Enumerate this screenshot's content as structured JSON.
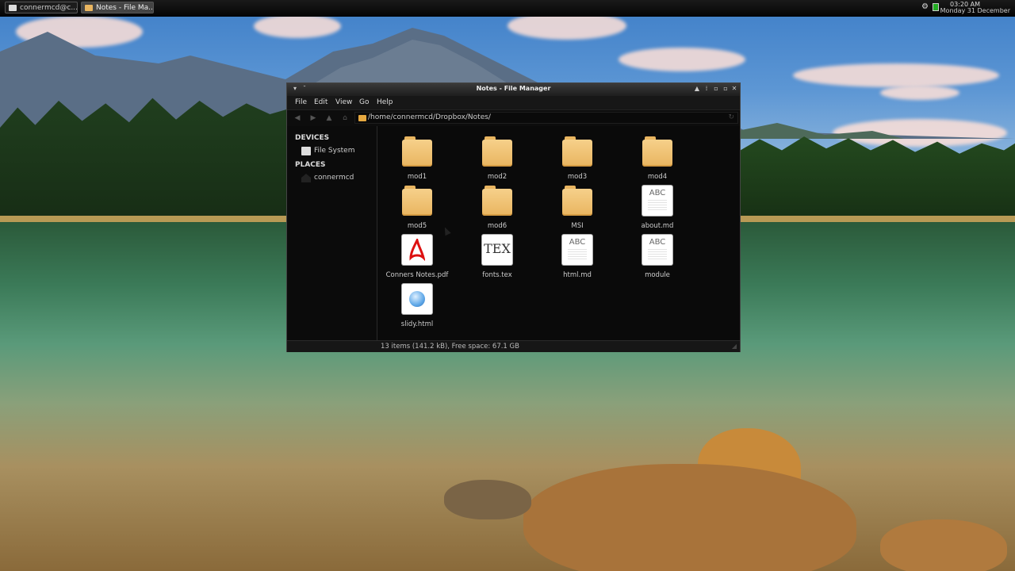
{
  "taskbar": {
    "tasks": [
      {
        "label": "connermcd@c...",
        "active": false
      },
      {
        "label": "Notes - File Ma...",
        "active": true
      }
    ],
    "clock": {
      "time": "03:20 AM",
      "date": "Monday 31 December"
    }
  },
  "window": {
    "title": "Notes - File Manager",
    "menu": [
      "File",
      "Edit",
      "View",
      "Go",
      "Help"
    ],
    "path": "/home/connermcd/Dropbox/Notes/",
    "sidebar": {
      "devices_heading": "DEVICES",
      "devices": [
        {
          "label": "File System",
          "icon": "drive-icon"
        }
      ],
      "places_heading": "PLACES",
      "places": [
        {
          "label": "connermcd",
          "icon": "home-icon"
        }
      ]
    },
    "files": [
      {
        "name": "mod1",
        "type": "folder"
      },
      {
        "name": "mod2",
        "type": "folder"
      },
      {
        "name": "mod3",
        "type": "folder"
      },
      {
        "name": "mod4",
        "type": "folder"
      },
      {
        "name": "mod5",
        "type": "folder"
      },
      {
        "name": "mod6",
        "type": "folder"
      },
      {
        "name": "MSI",
        "type": "folder"
      },
      {
        "name": "about.md",
        "type": "text",
        "glyph": "ABC"
      },
      {
        "name": "Conners Notes.pdf",
        "type": "pdf"
      },
      {
        "name": "fonts.tex",
        "type": "tex",
        "glyph": "TEX"
      },
      {
        "name": "html.md",
        "type": "text",
        "glyph": "ABC"
      },
      {
        "name": "module",
        "type": "text",
        "glyph": "ABC"
      },
      {
        "name": "slidy.html",
        "type": "html"
      }
    ],
    "status": "13 items (141.2 kB), Free space: 67.1 GB"
  },
  "colors": {
    "folder": "#e9b560",
    "panel": "#0d0d0d",
    "window_bg": "#111111"
  }
}
